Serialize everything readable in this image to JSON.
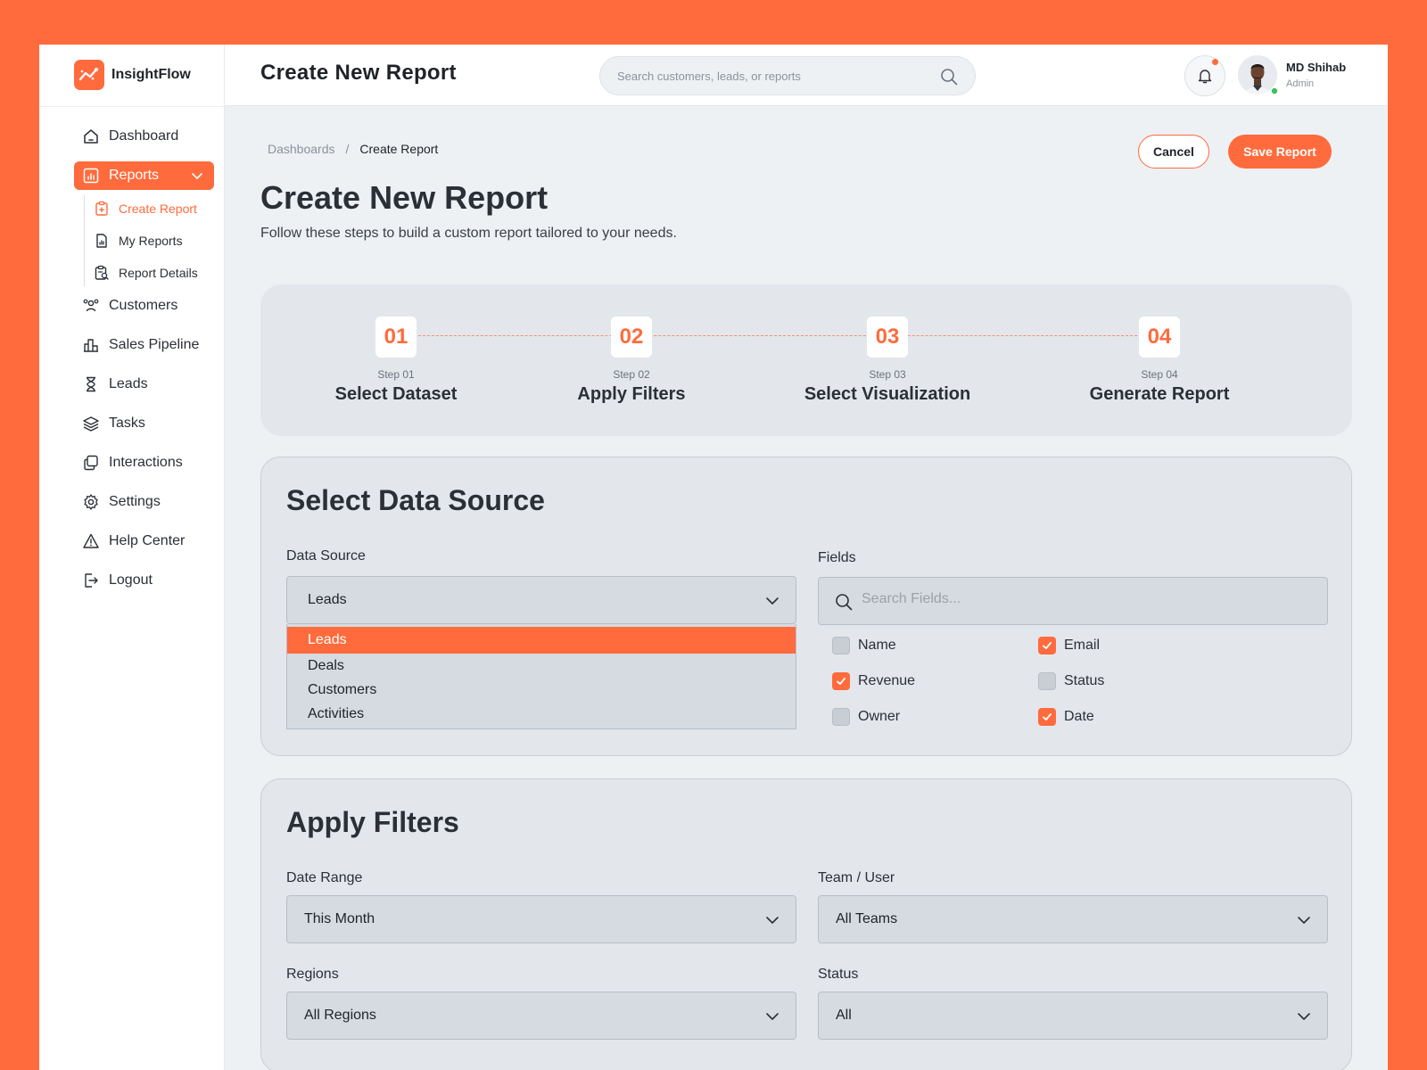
{
  "brand": {
    "name": "InsightFlow"
  },
  "colors": {
    "accent": "#FF6B3D",
    "background": "#EEF1F4",
    "card": "#E3E7EC"
  },
  "sidebar": {
    "items": [
      {
        "label": "Dashboard",
        "icon": "home-icon"
      },
      {
        "label": "Reports",
        "icon": "chart-icon",
        "active": true
      },
      {
        "label": "Customers",
        "icon": "users-icon"
      },
      {
        "label": "Sales Pipeline",
        "icon": "bar-chart-icon"
      },
      {
        "label": "Leads",
        "icon": "hourglass-icon"
      },
      {
        "label": "Tasks",
        "icon": "layers-icon"
      },
      {
        "label": "Interactions",
        "icon": "copy-icon"
      },
      {
        "label": "Settings",
        "icon": "gear-icon"
      },
      {
        "label": "Help Center",
        "icon": "warning-icon"
      },
      {
        "label": "Logout",
        "icon": "logout-icon"
      }
    ],
    "sub_items": [
      {
        "label": "Create Report",
        "icon": "clipboard-plus-icon",
        "active": true
      },
      {
        "label": "My Reports",
        "icon": "file-chart-icon"
      },
      {
        "label": "Report Details",
        "icon": "clipboard-search-icon"
      }
    ]
  },
  "header": {
    "title": "Create New Report",
    "search_placeholder": "Search customers, leads, or reports",
    "user": {
      "name": "MD Shihab",
      "role": "Admin"
    }
  },
  "breadcrumb": {
    "parent": "Dashboards",
    "separator": "/",
    "current": "Create Report"
  },
  "actions": {
    "cancel": "Cancel",
    "save": "Save Report"
  },
  "page": {
    "title": "Create New Report",
    "subtitle": "Follow these steps to build a custom report tailored to your needs."
  },
  "steps": [
    {
      "num": "01",
      "label": "Step 01",
      "name": "Select Dataset"
    },
    {
      "num": "02",
      "label": "Step 02",
      "name": "Apply Filters"
    },
    {
      "num": "03",
      "label": "Step 03",
      "name": "Select Visualization"
    },
    {
      "num": "04",
      "label": "Step 04",
      "name": "Generate Report"
    }
  ],
  "data_source": {
    "title": "Select Data Source",
    "source_label": "Data Source",
    "selected": "Leads",
    "options": [
      "Leads",
      "Deals",
      "Customers",
      "Activities"
    ],
    "fields_label": "Fields",
    "fields_placeholder": "Search Fields...",
    "fields": [
      {
        "label": "Name",
        "checked": false
      },
      {
        "label": "Email",
        "checked": true
      },
      {
        "label": "Revenue",
        "checked": true
      },
      {
        "label": "Status",
        "checked": false
      },
      {
        "label": "Owner",
        "checked": false
      },
      {
        "label": "Date",
        "checked": true
      }
    ]
  },
  "filters": {
    "title": "Apply Filters",
    "date_range": {
      "label": "Date Range",
      "value": "This Month"
    },
    "team": {
      "label": "Team / User",
      "value": "All Teams"
    },
    "regions": {
      "label": "Regions",
      "value": "All Regions"
    },
    "status": {
      "label": "Status",
      "value": "All"
    }
  }
}
